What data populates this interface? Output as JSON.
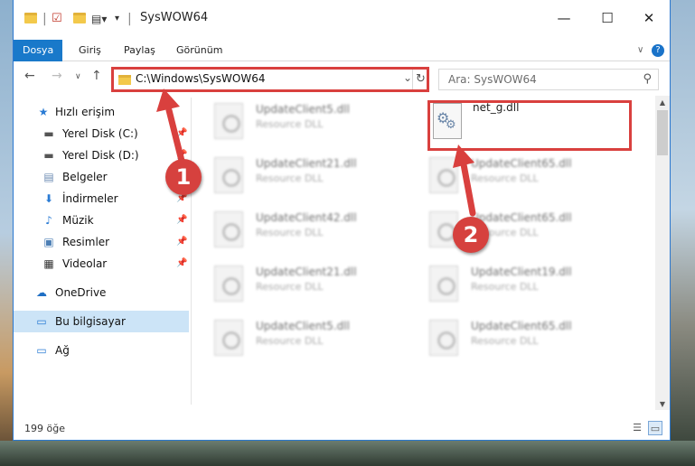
{
  "window": {
    "title": "SysWOW64"
  },
  "ribbon": {
    "tabs": [
      "Dosya",
      "Giriş",
      "Paylaş",
      "Görünüm"
    ]
  },
  "address": {
    "path": "C:\\Windows\\SysWOW64"
  },
  "search": {
    "placeholder": "Ara: SysWOW64"
  },
  "sidebar": {
    "items": [
      {
        "label": "Hızlı erişim",
        "icon": "star-icon"
      },
      {
        "label": "Yerel Disk (C:)",
        "icon": "drive-icon",
        "pinned": true
      },
      {
        "label": "Yerel Disk (D:)",
        "icon": "drive-icon",
        "pinned": true
      },
      {
        "label": "Belgeler",
        "icon": "documents-icon",
        "pinned": true
      },
      {
        "label": "İndirmeler",
        "icon": "downloads-icon",
        "pinned": true
      },
      {
        "label": "Müzik",
        "icon": "music-icon",
        "pinned": true
      },
      {
        "label": "Resimler",
        "icon": "pictures-icon",
        "pinned": true
      },
      {
        "label": "Videolar",
        "icon": "videos-icon",
        "pinned": true
      },
      {
        "label": "OneDrive",
        "icon": "cloud-icon"
      },
      {
        "label": "Bu bilgisayar",
        "icon": "computer-icon",
        "selected": true
      },
      {
        "label": "Ağ",
        "icon": "network-icon"
      }
    ]
  },
  "files": {
    "left": [
      {
        "name": "UpdateClient5.dll",
        "type": "Resource DLL"
      },
      {
        "name": "UpdateClient21.dll",
        "type": "Resource DLL"
      },
      {
        "name": "UpdateClient42.dll",
        "type": "Resource DLL"
      },
      {
        "name": "UpdateClient21.dll",
        "type": "Resource DLL"
      },
      {
        "name": "UpdateClient5.dll",
        "type": "Resource DLL"
      }
    ],
    "right": [
      {
        "name": "UpdateClient65.dll",
        "type": "Resource DLL"
      },
      {
        "name": "UpdateClient65.dll",
        "type": "Resource DLL"
      },
      {
        "name": "UpdateClient19.dll",
        "type": "Resource DLL"
      },
      {
        "name": "UpdateClient65.dll",
        "type": "Resource DLL"
      }
    ],
    "highlighted": {
      "name": "net_g.dll"
    }
  },
  "status": {
    "item_count": "199 öğe"
  },
  "annotations": {
    "step1": "1",
    "step2": "2",
    "color": "#d9403e"
  }
}
